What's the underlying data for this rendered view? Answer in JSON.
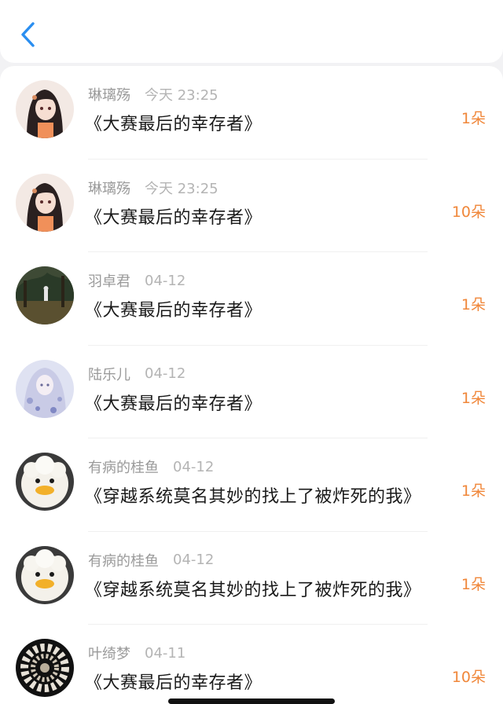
{
  "nav": {
    "back_icon": "chevron-left-icon",
    "accent": "#2a8ef0"
  },
  "list": {
    "items": [
      {
        "user": "琳璃殇",
        "time": "今天 23:25",
        "title": "《大赛最后的幸存者》",
        "gift": "1朵",
        "avatar": "anime-girl"
      },
      {
        "user": "琳璃殇",
        "time": "今天 23:25",
        "title": "《大赛最后的幸存者》",
        "gift": "10朵",
        "avatar": "anime-girl"
      },
      {
        "user": "羽卓君",
        "time": "04-12",
        "title": "《大赛最后的幸存者》",
        "gift": "1朵",
        "avatar": "dark-forest"
      },
      {
        "user": "陆乐儿",
        "time": "04-12",
        "title": "《大赛最后的幸存者》",
        "gift": "1朵",
        "avatar": "pale-girl"
      },
      {
        "user": "有病的桂鱼",
        "time": "04-12",
        "title": "《穿越系统莫名其妙的找上了被炸死的我》",
        "gift": "1朵",
        "avatar": "fluffy-duck"
      },
      {
        "user": "有病的桂鱼",
        "time": "04-12",
        "title": "《穿越系统莫名其妙的找上了被炸死的我》",
        "gift": "1朵",
        "avatar": "fluffy-duck"
      },
      {
        "user": "叶绮梦",
        "time": "04-11",
        "title": "《大赛最后的幸存者》",
        "gift": "10朵",
        "avatar": "white-wreath"
      }
    ]
  },
  "colors": {
    "gift": "#f0873a",
    "username": "#9a9a9a",
    "title": "#1a1a1a"
  }
}
